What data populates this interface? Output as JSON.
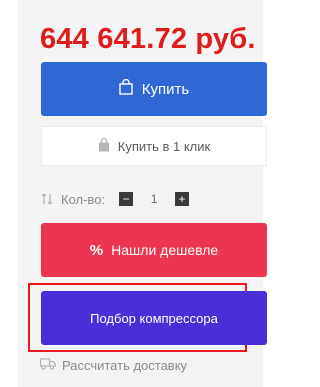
{
  "product": {
    "price": "644 641.72 руб."
  },
  "actions": {
    "buy_label": "Купить",
    "one_click_label": "Купить в 1 клик",
    "quantity_label": "Кол-во:",
    "quantity_minus": "−",
    "quantity_value": "1",
    "quantity_plus": "+",
    "found_cheaper_symbol": "%",
    "found_cheaper_label": "Нашли дешевле",
    "compressor_selection_label": "Подбор компрессора",
    "delivery_label": "Рассчитать доставку"
  },
  "colors": {
    "price": "#e01b1b",
    "buy_button": "#2f67d4",
    "cheaper_button": "#ec3651",
    "compressor_button": "#4a2fd8",
    "highlight_outline": "#e8171b"
  },
  "icons": {
    "buy": "shopping-bag-icon",
    "one_click": "shopping-bag-icon",
    "quantity": "sort-arrows-icon",
    "delivery": "truck-icon"
  }
}
